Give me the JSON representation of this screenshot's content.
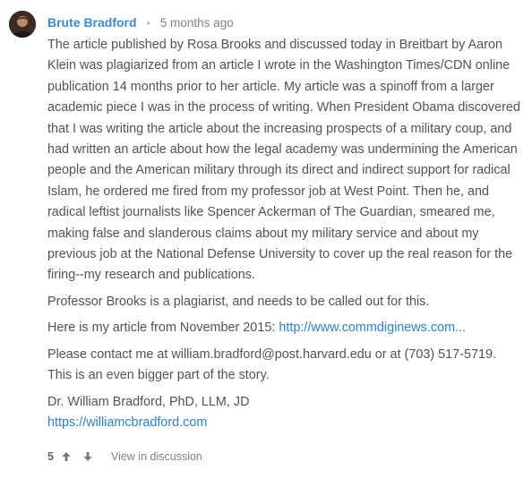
{
  "comment": {
    "author": "Brute Bradford",
    "separator": "•",
    "time": "5 months ago",
    "paragraphs": [
      "The article published by Rosa Brooks and discussed today in Breitbart by Aaron Klein was plagiarized from an article I wrote in the Washington Times/CDN online publication 14 months prior to her article. My article was a spinoff from a larger academic piece I was in the process of writing. When President Obama discovered that I was writing the article about the increasing prospects of a military coup, and had written an article about how the legal academy was undermining the American people and the American military through its direct and indirect support for radical Islam, he ordered me fired from my professor job at West Point. Then he, and radical leftist journalists like Spencer Ackerman of The Guardian, smeared me, making false and slanderous claims about my military service and about my previous job at the National Defense University to cover up the real reason for the firing--my research and publications.",
      "Professor Brooks is a plagiarist, and needs to be called out for this."
    ],
    "article_prefix": "Here is my article from November 2015: ",
    "article_link": "http://www.commdiginews.com...",
    "contact_line1": "Please contact me at william.bradford@post.harvard.edu or at (703) 517-5719.",
    "contact_line2": "This is an even bigger part of the story.",
    "signature_name": "Dr. William Bradford, PhD, LLM, JD",
    "signature_link": "https://williamcbradford.com"
  },
  "footer": {
    "vote_count": "5",
    "view_label": "View in discussion"
  },
  "colors": {
    "author": "#3a8ad8",
    "link": "#2a7fd4",
    "text": "#4d545b",
    "muted": "#7b848c"
  },
  "icons": {
    "avatar": "user-avatar",
    "upvote": "arrow-up-icon",
    "downvote": "arrow-down-icon"
  }
}
